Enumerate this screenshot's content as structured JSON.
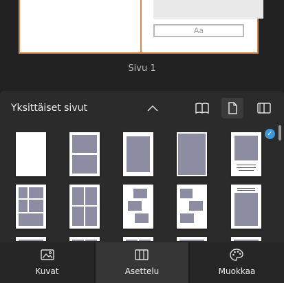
{
  "preview": {
    "text_placeholder": "Aa",
    "page_label": "Sivu 1"
  },
  "panel": {
    "title": "Yksittäiset sivut",
    "view_options": [
      "book-view-icon",
      "single-page-icon",
      "spread-view-icon"
    ],
    "selected_view": "single-page-icon",
    "selected_layout_index": 4,
    "layout_count_visible": 15
  },
  "tabs": [
    {
      "label": "Kuvat",
      "icon": "image-icon"
    },
    {
      "label": "Asettelu",
      "icon": "layout-columns-icon"
    },
    {
      "label": "Muokkaa",
      "icon": "palette-icon"
    }
  ],
  "colors": {
    "accent": "#3a96dd",
    "page_border": "#d98a4a",
    "placeholder": "#8c8ca3"
  }
}
